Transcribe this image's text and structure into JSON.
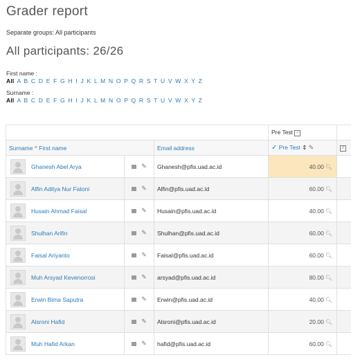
{
  "page": {
    "title": "Grader report"
  },
  "groups": {
    "text": "Separate groups: All participants"
  },
  "participants": {
    "text": "All participants: 26/26"
  },
  "initials": {
    "first_name_label": "First name :",
    "surname_label": "Surname :",
    "all_label": "All",
    "letters": [
      "A",
      "B",
      "C",
      "D",
      "E",
      "F",
      "G",
      "H",
      "I",
      "J",
      "K",
      "L",
      "M",
      "N",
      "O",
      "P",
      "Q",
      "R",
      "S",
      "T",
      "U",
      "V",
      "W",
      "X",
      "Y",
      "Z"
    ]
  },
  "table": {
    "category": "Pre Test",
    "col_name": "Surname ^ First name",
    "col_email": "Email address",
    "col_grade": "Pre Test",
    "rows": [
      {
        "name": "Ghanesh Abel Arya",
        "email": "Ghanesh@pfis.uad.ac.id",
        "grade": "40.00"
      },
      {
        "name": "Alfin Aditya Nur Fatoni",
        "email": "Alfin@pfis.uad.ac.id",
        "grade": "60.00"
      },
      {
        "name": "Husain Ahmad Faisal",
        "email": "Husain@pfis.uad.ac.id",
        "grade": "40.00"
      },
      {
        "name": "Shulhan Arifin",
        "email": "Shulhan@pfis.uad.ac.id",
        "grade": "60.00"
      },
      {
        "name": "Faisal Ariyanto",
        "email": "Faisal@pfis.uad.ac.id",
        "grade": "60.00"
      },
      {
        "name": "Muh Arsyad Kevenorrosi",
        "email": "arsyad@pfis.uad.ac.id",
        "grade": "80.00"
      },
      {
        "name": "Erwin Bima Saputra",
        "email": "Erwin@pfis.uad.ac.id",
        "grade": "40.00"
      },
      {
        "name": "Alsroni Hafid",
        "email": "Alsroni@pfis.uad.ac.id",
        "grade": "20.00"
      },
      {
        "name": "Muh Hafid Arkan",
        "email": "hafid@pfis.uad.ac.id",
        "grade": "60.00"
      }
    ]
  },
  "icons": {
    "sort": "sort-ascending-icon",
    "collapse": "collapse-icon",
    "report": "user-report-icon",
    "edit": "pencil-icon",
    "analysis": "magnifier-icon",
    "quiz": "quiz-icon"
  },
  "colors": {
    "link": "#2a7ab8",
    "highlight": "#fbe6bd"
  }
}
